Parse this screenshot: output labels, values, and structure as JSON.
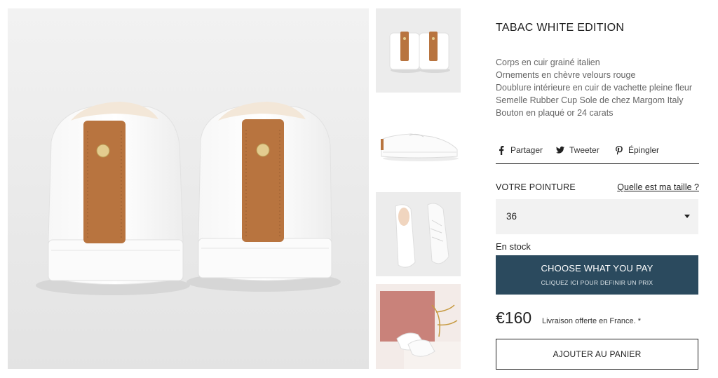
{
  "product": {
    "title": "TABAC WHITE EDITION",
    "description": [
      "Corps en cuir grainé italien",
      "Ornements en chèvre velours rouge",
      "Doublure intérieure en cuir de vachette pleine fleur",
      "Semelle Rubber Cup Sole de chez Margom Italy",
      "Bouton en plaqué or 24 carats"
    ],
    "images": {
      "main": "white-sneakers-rear-view",
      "thumbnails": [
        "sneakers-rear-view",
        "sneaker-side-view",
        "sneakers-top-view",
        "sneakers-on-pink-backdrop"
      ]
    }
  },
  "share": {
    "facebook": {
      "label": "Partager",
      "icon": "facebook-icon"
    },
    "twitter": {
      "label": "Tweeter",
      "icon": "twitter-icon"
    },
    "pinterest": {
      "label": "Épingler",
      "icon": "pinterest-icon"
    }
  },
  "size": {
    "label": "VOTRE POINTURE",
    "guide_link": "Quelle est ma taille ?",
    "selected": "36"
  },
  "stock_status": "En stock",
  "choose_price_button": {
    "title": "CHOOSE WHAT YOU PAY",
    "subtitle": "CLIQUEZ ICI POUR DEFINIR UN PRIX"
  },
  "price": "€160",
  "shipping_note": "Livraison offerte en France. *",
  "add_to_cart_label": "AJOUTER AU PANIER",
  "colors": {
    "accent_button": "#2b4a5e",
    "suede_tan": "#b8743f",
    "backdrop_pink": "#c9827a"
  }
}
